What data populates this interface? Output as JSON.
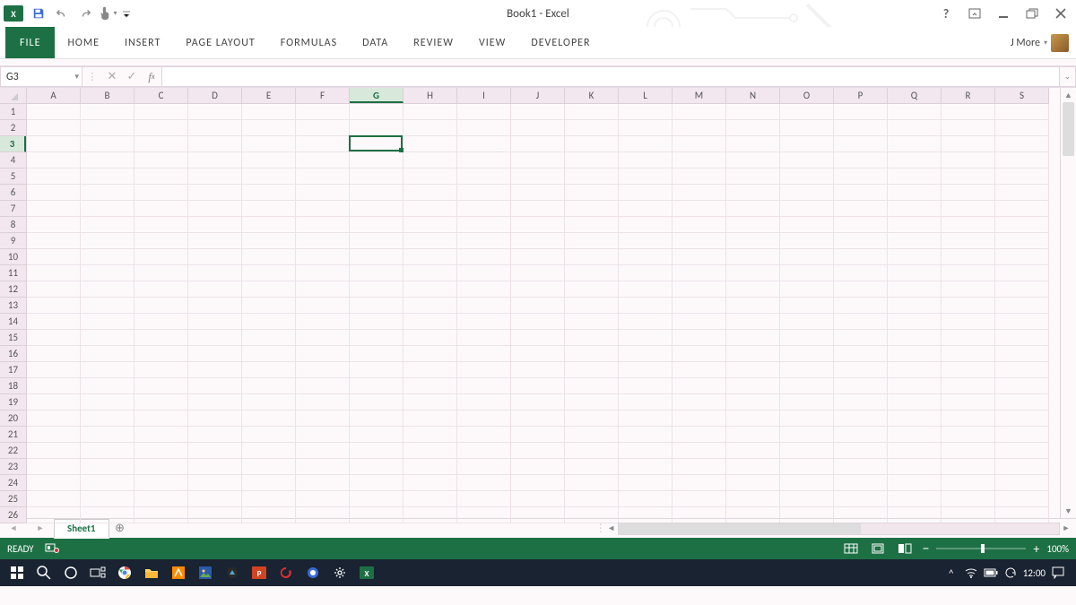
{
  "title": "Book1 - Excel",
  "qat": {
    "app_icon": "X"
  },
  "ribbon": {
    "file": "FILE",
    "tabs": [
      "HOME",
      "INSERT",
      "PAGE LAYOUT",
      "FORMULAS",
      "DATA",
      "REVIEW",
      "VIEW",
      "DEVELOPER"
    ]
  },
  "user": {
    "name": "J More"
  },
  "help_symbol": "?",
  "namebox": "G3",
  "formula": "",
  "columns": [
    "A",
    "B",
    "C",
    "D",
    "E",
    "F",
    "G",
    "H",
    "I",
    "J",
    "K",
    "L",
    "M",
    "N",
    "O",
    "P",
    "Q",
    "R",
    "S"
  ],
  "rows": [
    "1",
    "2",
    "3",
    "4",
    "5",
    "6",
    "7",
    "8",
    "9",
    "10",
    "11",
    "12",
    "13",
    "14",
    "15",
    "16",
    "17",
    "18",
    "19",
    "20",
    "21",
    "22",
    "23",
    "24",
    "25",
    "26"
  ],
  "selected": {
    "col_index": 6,
    "row_index": 2
  },
  "sheet_tab": "Sheet1",
  "status": {
    "ready": "READY",
    "zoom": "100%"
  },
  "taskbar": {
    "clock": "12:00"
  }
}
